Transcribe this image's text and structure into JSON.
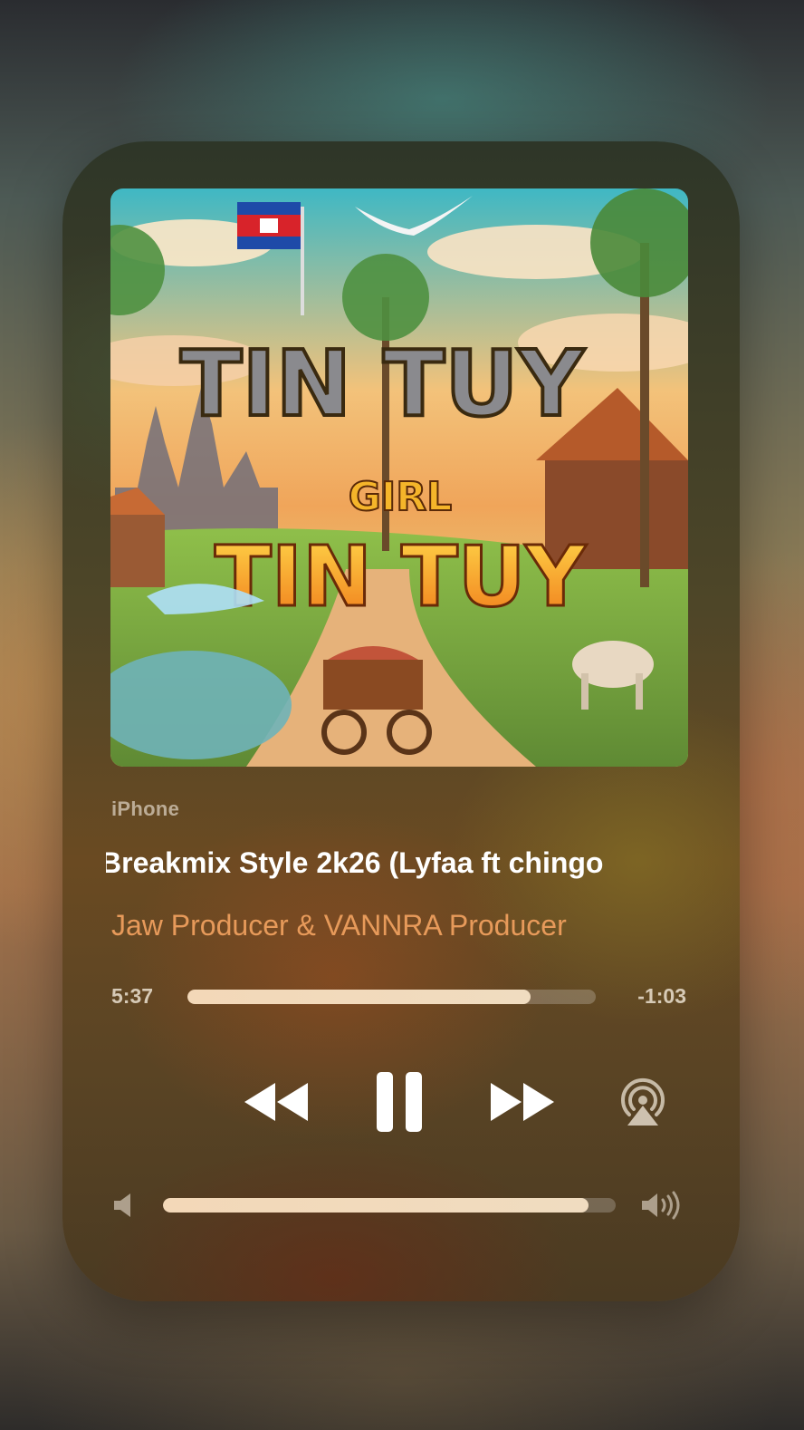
{
  "player": {
    "source": "iPhone",
    "track_title": "Breakmix Style 2k26 (Lyfaa ft chingo",
    "artist": "Jaw Producer & VANNRA Producer",
    "elapsed": "5:37",
    "remaining": "-1:03",
    "progress_fraction": 0.84,
    "volume_fraction": 0.94,
    "artwork": {
      "title_top": "TIN TUY",
      "title_mid": "GIRL",
      "title_bottom": "TIN TUY"
    },
    "controls": {
      "rewind_icon": "rewind-icon",
      "pause_icon": "pause-icon",
      "forward_icon": "fast-forward-icon",
      "airplay_icon": "airplay-audio-icon",
      "volume_low_icon": "speaker-low-icon",
      "volume_high_icon": "speaker-high-icon"
    },
    "colors": {
      "artist": "#e79a5a",
      "title": "#ffffff",
      "bar_fill": "#f0dcc0"
    }
  }
}
